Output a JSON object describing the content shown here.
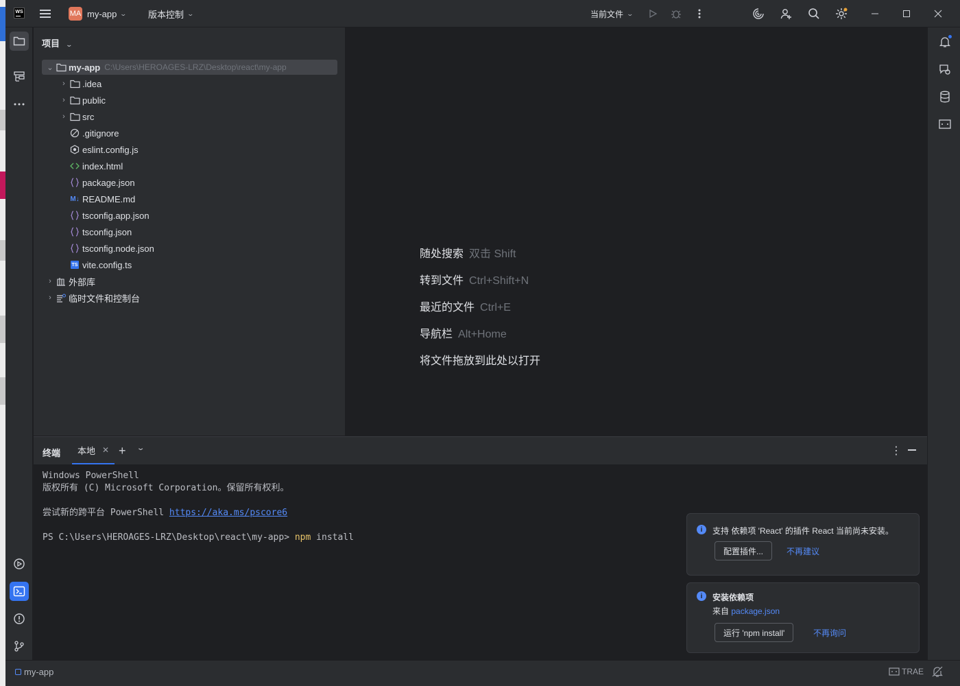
{
  "titlebar": {
    "logo": "WS",
    "menu_icon": "hamburger-icon",
    "project_badge": "MA",
    "project_name": "my-app",
    "vcs_menu": "版本控制",
    "run_config": "当前文件"
  },
  "project_panel": {
    "header": "项目",
    "root": {
      "name": "my-app",
      "path": "C:\\Users\\HEROAGES-LRZ\\Desktop\\react\\my-app"
    },
    "items": [
      {
        "name": ".idea",
        "kind": "folder",
        "expandable": true
      },
      {
        "name": "public",
        "kind": "folder",
        "expandable": true
      },
      {
        "name": "src",
        "kind": "folder",
        "expandable": true
      },
      {
        "name": ".gitignore",
        "kind": "ignore-file",
        "expandable": false
      },
      {
        "name": "eslint.config.js",
        "kind": "eslint-file",
        "expandable": false
      },
      {
        "name": "index.html",
        "kind": "html-file",
        "expandable": false
      },
      {
        "name": "package.json",
        "kind": "json-file",
        "expandable": false
      },
      {
        "name": "README.md",
        "kind": "markdown-file",
        "expandable": false
      },
      {
        "name": "tsconfig.app.json",
        "kind": "json-file",
        "expandable": false
      },
      {
        "name": "tsconfig.json",
        "kind": "json-file",
        "expandable": false
      },
      {
        "name": "tsconfig.node.json",
        "kind": "json-file",
        "expandable": false
      },
      {
        "name": "vite.config.ts",
        "kind": "ts-file",
        "expandable": false
      }
    ],
    "external_libs": "外部库",
    "scratches": "临时文件和控制台"
  },
  "editor_hints": [
    {
      "label": "随处搜索",
      "key": "双击 Shift"
    },
    {
      "label": "转到文件",
      "key": "Ctrl+Shift+N"
    },
    {
      "label": "最近的文件",
      "key": "Ctrl+E"
    },
    {
      "label": "导航栏",
      "key": "Alt+Home"
    },
    {
      "label": "将文件拖放到此处以打开",
      "key": ""
    }
  ],
  "terminal": {
    "title": "终端",
    "tab": "本地",
    "line1": "Windows PowerShell",
    "line2": "版权所有 (C) Microsoft Corporation。保留所有权利。",
    "line3_prefix": "尝试新的跨平台 PowerShell ",
    "line3_link": "https://aka.ms/pscore6",
    "prompt": "PS C:\\Users\\HEROAGES-LRZ\\Desktop\\react\\my-app> ",
    "cmd": "npm",
    "arg": " install"
  },
  "notifications": [
    {
      "text": "支持 依赖项 'React' 的插件 React 当前尚未安装。",
      "button": "配置插件...",
      "link": "不再建议"
    },
    {
      "title": "安装依赖项",
      "from_label": "来自 ",
      "from_link": "package.json",
      "button": "运行 'npm install'",
      "link": "不再询问"
    }
  ],
  "statusbar": {
    "project": "my-app",
    "trae": "TRAE"
  },
  "colors": {
    "accent": "#3574f0",
    "link": "#548af7",
    "project_badge": "#e0775b",
    "command": "#e8c46a"
  }
}
